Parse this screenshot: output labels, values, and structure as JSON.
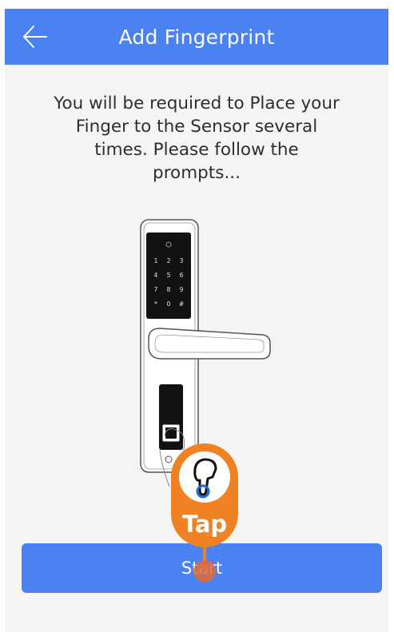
{
  "header": {
    "title": "Add Fingerprint"
  },
  "instructions": {
    "text": "You will be required to Place your Finger to the Sensor several times. Please follow the prompts..."
  },
  "keypad": {
    "keys": [
      "1",
      "2",
      "3",
      "4",
      "5",
      "6",
      "7",
      "8",
      "9",
      "*",
      "0",
      "#"
    ]
  },
  "start_button": {
    "label": "Start"
  },
  "tap_hint": {
    "label": "Tap"
  },
  "colors": {
    "primary": "#4a82f4",
    "background": "#f4f4f4",
    "tap_orange": "#f08223"
  }
}
